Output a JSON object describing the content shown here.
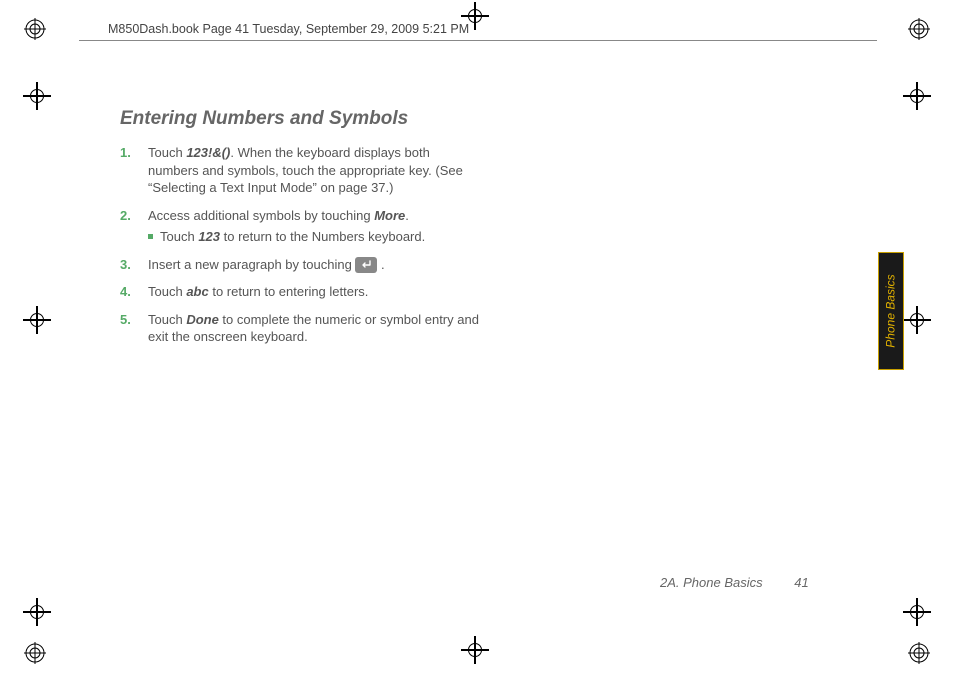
{
  "header": {
    "doc_path": "M850Dash.book  Page 41  Tuesday, September 29, 2009  5:21 PM"
  },
  "title": "Entering Numbers and Symbols",
  "steps": [
    {
      "n": "1.",
      "pre": "Touch ",
      "em": "123!&()",
      "post": ". When the keyboard displays both numbers and symbols, touch the appropriate key. (See “Selecting a Text Input Mode” on page 37.)"
    },
    {
      "n": "2.",
      "pre": "Access additional symbols by touching ",
      "em": "More",
      "post": ".",
      "sub_pre": "Touch ",
      "sub_em": "123",
      "sub_post": " to return to the Numbers keyboard."
    },
    {
      "n": "3.",
      "pre": "Insert a new paragraph by touching ",
      "icon": "return-key-icon",
      "post": " ."
    },
    {
      "n": "4.",
      "pre": "Touch ",
      "em": "abc",
      "post": " to return to entering letters."
    },
    {
      "n": "5.",
      "pre": "Touch ",
      "em": "Done",
      "post": " to complete the numeric or symbol entry and exit the onscreen keyboard."
    }
  ],
  "sidetab": {
    "label": "Phone Basics"
  },
  "footer": {
    "section": "2A. Phone Basics",
    "page": "41"
  }
}
